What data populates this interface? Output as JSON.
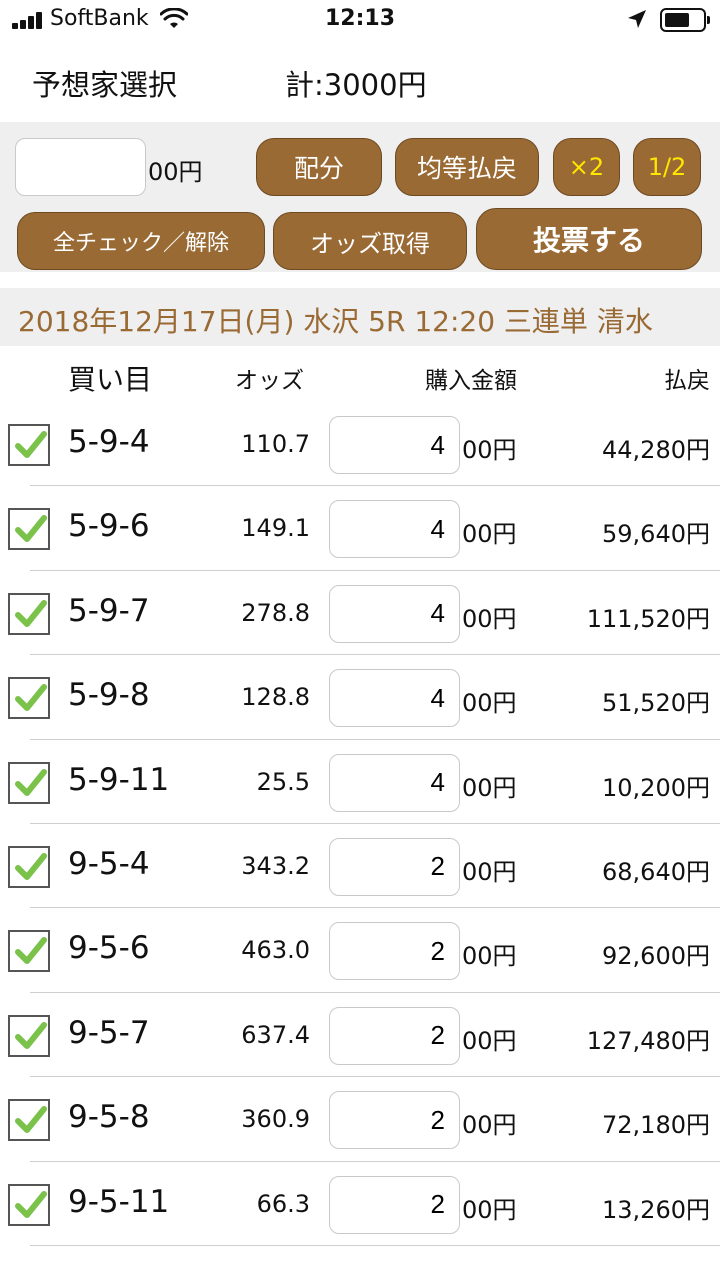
{
  "status_bar": {
    "carrier": "SoftBank",
    "time": "12:13"
  },
  "header": {
    "title": "予想家選択",
    "total": "計:3000円"
  },
  "controls": {
    "amount_value": "",
    "amount_suffix": "00円",
    "haibun_label": "配分",
    "kinto_label": "均等払戻",
    "x2_label": "×2",
    "half_label": "1/2",
    "check_all_label": "全チェック／解除",
    "get_odds_label": "オッズ取得",
    "vote_label": "投票する",
    "accent_color": "#9a6a34",
    "highlight_color": "#ffe600"
  },
  "race": {
    "info": "2018年12月17日(月) 水沢 5R 12:20 三連単 清水"
  },
  "columns": {
    "ticket": "買い目",
    "odds": "オッズ",
    "amount": "購入金額",
    "payout": "払戻"
  },
  "rows": [
    {
      "ticket": "5-9-4",
      "odds": "110.7",
      "amount": "4",
      "suffix": "00円",
      "payout": "44,280円",
      "checked": true
    },
    {
      "ticket": "5-9-6",
      "odds": "149.1",
      "amount": "4",
      "suffix": "00円",
      "payout": "59,640円",
      "checked": true
    },
    {
      "ticket": "5-9-7",
      "odds": "278.8",
      "amount": "4",
      "suffix": "00円",
      "payout": "111,520円",
      "checked": true
    },
    {
      "ticket": "5-9-8",
      "odds": "128.8",
      "amount": "4",
      "suffix": "00円",
      "payout": "51,520円",
      "checked": true
    },
    {
      "ticket": "5-9-11",
      "odds": "25.5",
      "amount": "4",
      "suffix": "00円",
      "payout": "10,200円",
      "checked": true
    },
    {
      "ticket": "9-5-4",
      "odds": "343.2",
      "amount": "2",
      "suffix": "00円",
      "payout": "68,640円",
      "checked": true
    },
    {
      "ticket": "9-5-6",
      "odds": "463.0",
      "amount": "2",
      "suffix": "00円",
      "payout": "92,600円",
      "checked": true
    },
    {
      "ticket": "9-5-7",
      "odds": "637.4",
      "amount": "2",
      "suffix": "00円",
      "payout": "127,480円",
      "checked": true
    },
    {
      "ticket": "9-5-8",
      "odds": "360.9",
      "amount": "2",
      "suffix": "00円",
      "payout": "72,180円",
      "checked": true
    },
    {
      "ticket": "9-5-11",
      "odds": "66.3",
      "amount": "2",
      "suffix": "00円",
      "payout": "13,260円",
      "checked": true
    }
  ]
}
